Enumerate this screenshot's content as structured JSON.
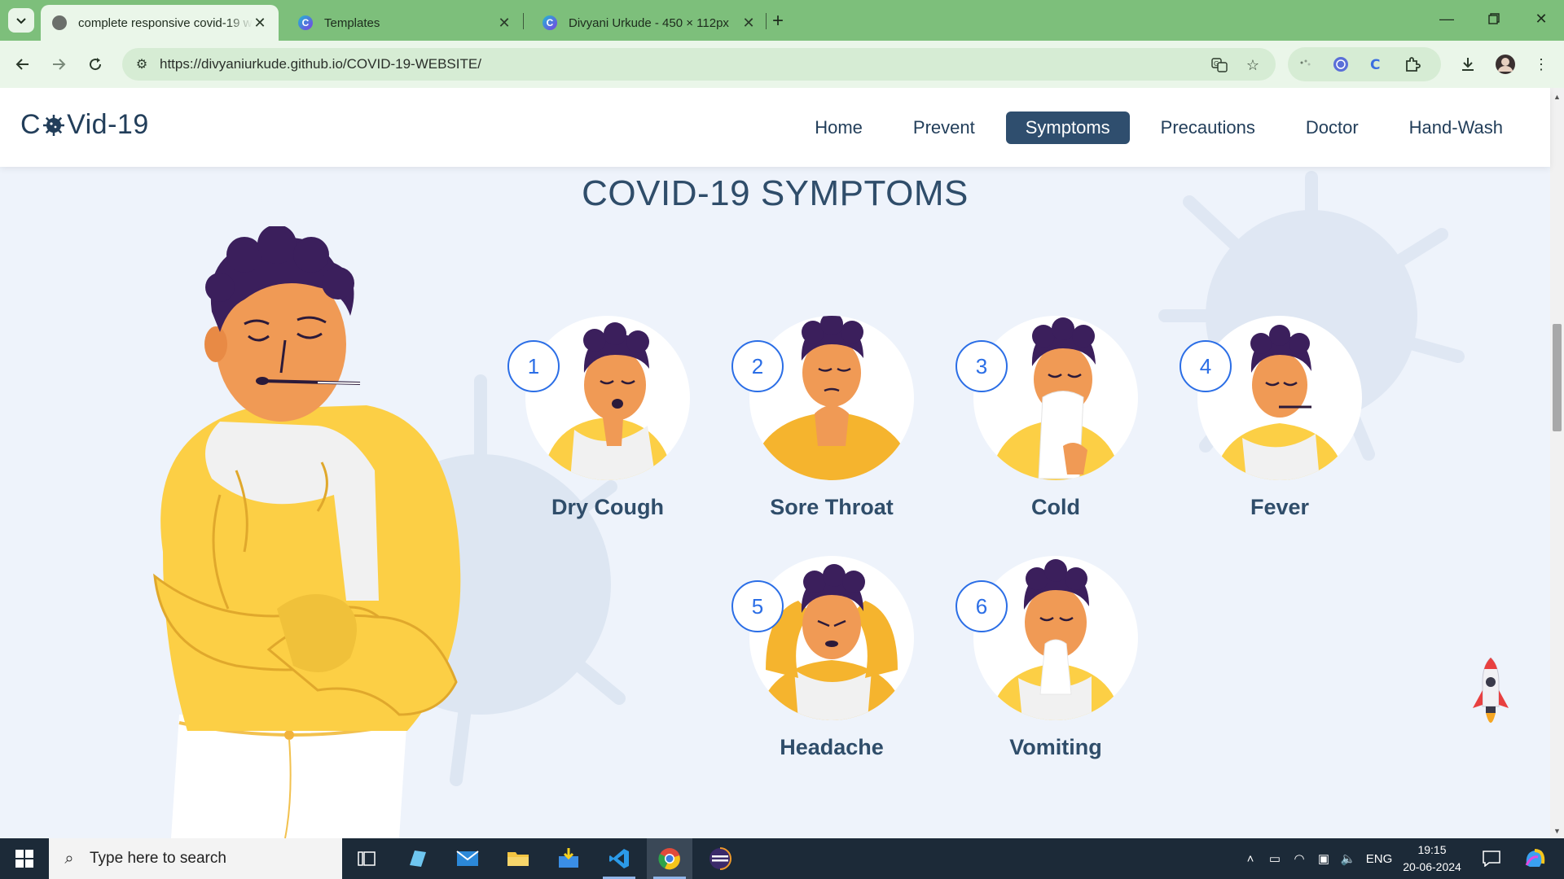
{
  "browser": {
    "tabs": [
      {
        "title": "complete responsive covid-19 w",
        "icon": "globe-icon",
        "active": true
      },
      {
        "title": "Templates",
        "icon": "canva-icon",
        "active": false
      },
      {
        "title": "Divyani Urkude - 450 × 112px",
        "icon": "canva-icon",
        "active": false
      }
    ],
    "url": "https://divyaniurkude.github.io/COVID-19-WEBSITE/"
  },
  "site": {
    "logo": {
      "prefix": "C",
      "suffix": "Vid-19"
    },
    "nav": [
      {
        "label": "Home",
        "active": false
      },
      {
        "label": "Prevent",
        "active": false
      },
      {
        "label": "Symptoms",
        "active": true
      },
      {
        "label": "Precautions",
        "active": false
      },
      {
        "label": "Doctor",
        "active": false
      },
      {
        "label": "Hand-Wash",
        "active": false
      }
    ],
    "section_title": "COVID-19 SYMPTOMS",
    "symptoms": [
      {
        "number": "1",
        "label": "Dry Cough"
      },
      {
        "number": "2",
        "label": "Sore Throat"
      },
      {
        "number": "3",
        "label": "Cold"
      },
      {
        "number": "4",
        "label": "Fever"
      },
      {
        "number": "5",
        "label": "Headache"
      },
      {
        "number": "6",
        "label": "Vomiting"
      }
    ],
    "colors": {
      "primary": "#2f4e6e",
      "accent_blue": "#2b6ee6",
      "shirt_yellow": "#fccf45",
      "hair": "#3b1f5c",
      "skin": "#f09a55"
    }
  },
  "taskbar": {
    "search_placeholder": "Type here to search",
    "language": "ENG",
    "time": "19:15",
    "date": "20-06-2024"
  }
}
